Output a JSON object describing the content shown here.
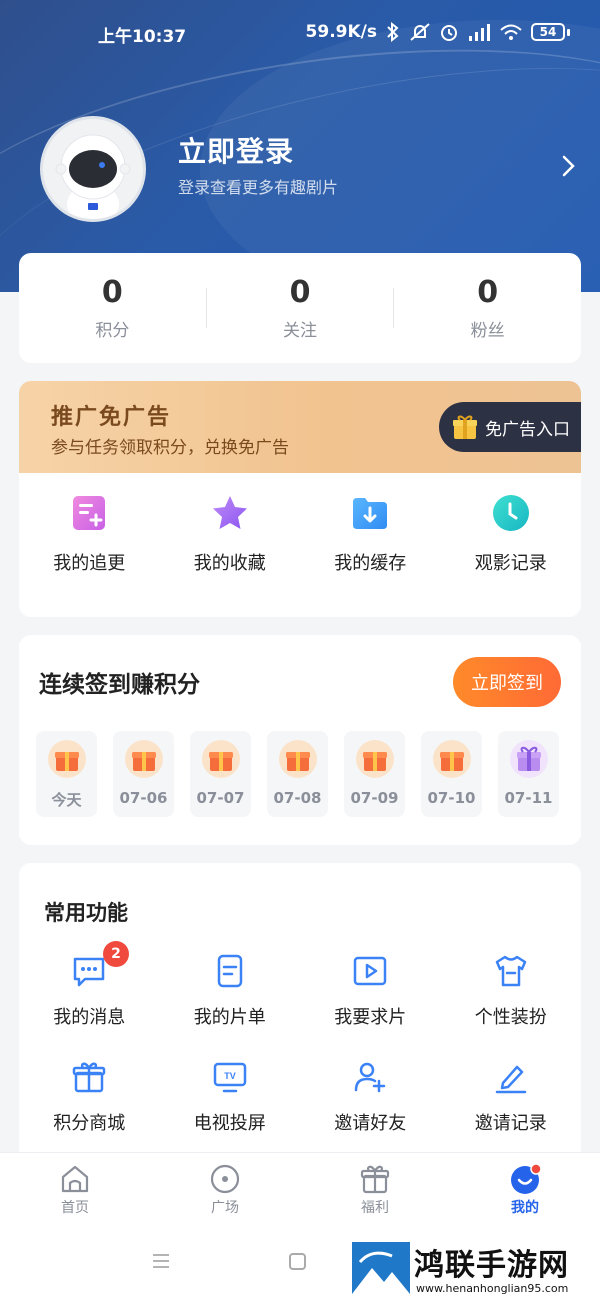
{
  "status_bar": {
    "time": "上午10:37",
    "speed": "59.9K/s",
    "battery": "54"
  },
  "profile": {
    "title": "立即登录",
    "subtitle": "登录查看更多有趣剧片"
  },
  "stats": [
    {
      "value": "0",
      "label": "积分"
    },
    {
      "value": "0",
      "label": "关注"
    },
    {
      "value": "0",
      "label": "粉丝"
    }
  ],
  "promo": {
    "title": "推广免广告",
    "subtitle": "参与任务领取积分，兑换免广告",
    "button": "免广告入口"
  },
  "quick_actions": [
    {
      "label": "我的追更",
      "icon": "list-add-icon",
      "color": "#d96ee0"
    },
    {
      "label": "我的收藏",
      "icon": "star-icon",
      "color": "#a56cf2"
    },
    {
      "label": "我的缓存",
      "icon": "folder-download-icon",
      "color": "#3b9cf5"
    },
    {
      "label": "观影记录",
      "icon": "clock-icon",
      "color": "#1fc7c7"
    }
  ],
  "checkin": {
    "title": "连续签到赚积分",
    "button": "立即签到",
    "days": [
      "今天",
      "07-06",
      "07-07",
      "07-08",
      "07-09",
      "07-10",
      "07-11"
    ]
  },
  "functions": {
    "title": "常用功能",
    "items": [
      {
        "label": "我的消息",
        "icon": "message-icon",
        "badge": "2"
      },
      {
        "label": "我的片单",
        "icon": "playlist-icon"
      },
      {
        "label": "我要求片",
        "icon": "request-video-icon"
      },
      {
        "label": "个性装扮",
        "icon": "tshirt-icon"
      },
      {
        "label": "积分商城",
        "icon": "gift-box-icon"
      },
      {
        "label": "电视投屏",
        "icon": "tv-icon"
      },
      {
        "label": "邀请好友",
        "icon": "add-user-icon"
      },
      {
        "label": "邀请记录",
        "icon": "edit-record-icon"
      }
    ]
  },
  "tabs": [
    {
      "label": "首页",
      "icon": "home-icon"
    },
    {
      "label": "广场",
      "icon": "plaza-icon"
    },
    {
      "label": "福利",
      "icon": "gift-icon"
    },
    {
      "label": "我的",
      "icon": "profile-icon",
      "active": true
    }
  ],
  "watermark": {
    "title": "鸿联手游网",
    "url": "www.henanhonglian95.com"
  },
  "colors": {
    "accent": "#2563eb",
    "orange": "#ff7a30",
    "header": "#2a5ba8",
    "badge": "#f04a3e"
  }
}
